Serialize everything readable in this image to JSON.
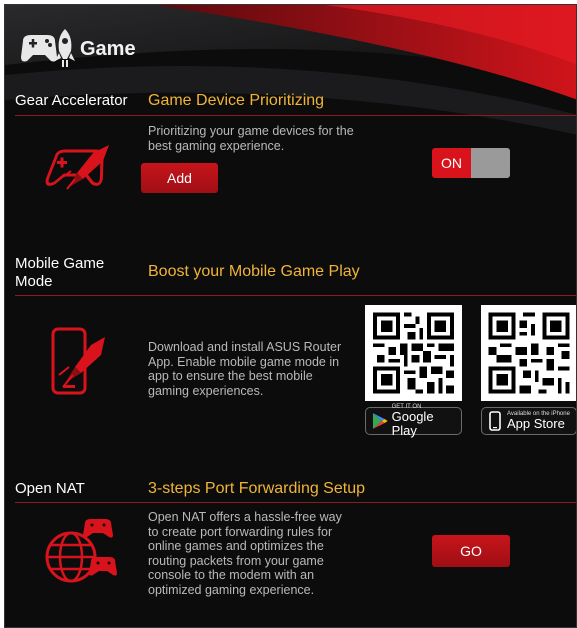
{
  "header": {
    "title": "Game",
    "logo_icon": "gamepad-rocket-icon"
  },
  "gear_accelerator": {
    "label": "Gear Accelerator",
    "title": "Game Device Prioritizing",
    "description_lines": [
      "Prioritizing your game devices for the",
      "best gaming experience."
    ],
    "add_button": "Add",
    "toggle_label": "ON",
    "toggle_state": "on",
    "icon": "gamepad-rocket-icon"
  },
  "mobile_game_mode": {
    "label_lines": [
      "Mobile Game",
      "Mode"
    ],
    "title": "Boost your Mobile Game Play",
    "description_lines": [
      "Download and install ASUS Router",
      "App. Enable mobile game mode in",
      "app to ensure the best mobile",
      "gaming experiences."
    ],
    "icon": "phone-rocket-icon",
    "google_play": {
      "small": "GET IT ON",
      "big": "Google Play",
      "icon": "google-play-icon"
    },
    "app_store": {
      "small": "Available on the iPhone",
      "big": "App Store",
      "icon": "iphone-icon"
    }
  },
  "open_nat": {
    "label": "Open NAT",
    "title": "3-steps Port Forwarding Setup",
    "description_lines": [
      "Open NAT offers a hassle-free way",
      "to create port forwarding rules for",
      "online games and optimizes the",
      "routing packets from your game",
      "console to the modem with an",
      "optimized gaming experience."
    ],
    "go_button": "GO",
    "icon": "globe-gamepads-icon"
  },
  "colors": {
    "accent_red": "#d8131c",
    "title_gold": "#f0b437",
    "background": "#0c0c0d"
  }
}
